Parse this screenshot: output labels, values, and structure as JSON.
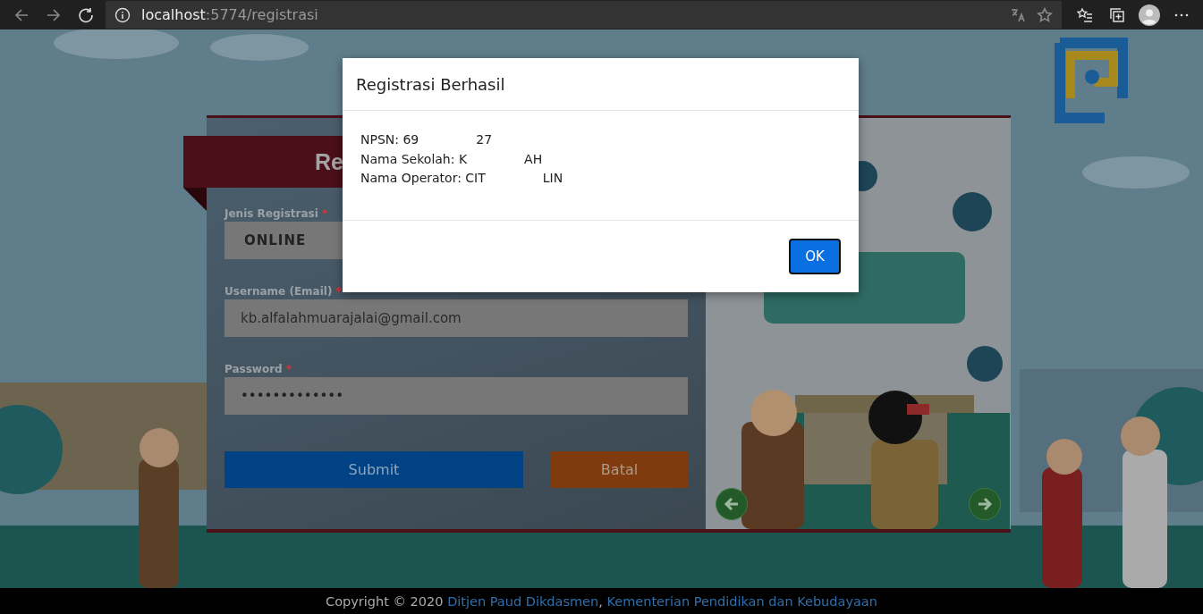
{
  "browser": {
    "url_host": "localhost",
    "url_rest": ":5774/registrasi"
  },
  "form": {
    "title": "Re",
    "fields": [
      {
        "label": "Jenis Registrasi",
        "required_mark": "*",
        "kind": "select",
        "value": "ONLINE"
      },
      {
        "label": "Username (Email)",
        "required_mark": "*",
        "kind": "text",
        "value": "kb.alfalahmuarajalai@gmail.com"
      },
      {
        "label": "Password",
        "required_mark": "*",
        "kind": "password",
        "value": "•••••••••••••"
      }
    ],
    "buttons": [
      {
        "label": "Submit",
        "kind": "primary"
      },
      {
        "label": "Batal",
        "kind": "cancel"
      }
    ]
  },
  "modal": {
    "title": "Registrasi Berhasil",
    "lines": [
      {
        "start": "NPSN: 69",
        "end": "27"
      },
      {
        "start": "Nama Sekolah: K",
        "end": "AH"
      },
      {
        "start": "Nama Operator: CIT",
        "end": "LIN"
      }
    ],
    "button": "OK"
  },
  "footer": {
    "text": "Copyright © 2020",
    "links": [
      "Ditjen Paud Dikdasmen",
      "Kementerian Pendidikan dan Kebudayaan"
    ],
    "separator": ","
  }
}
